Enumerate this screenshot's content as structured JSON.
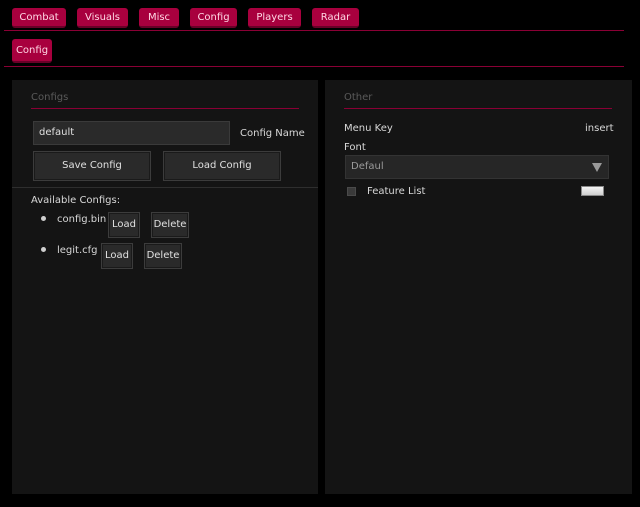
{
  "tabs": [
    {
      "label": "Combat"
    },
    {
      "label": "Visuals"
    },
    {
      "label": "Misc"
    },
    {
      "label": "Config"
    },
    {
      "label": "Players"
    },
    {
      "label": "Radar"
    }
  ],
  "subtab": {
    "label": "Config"
  },
  "configs_panel": {
    "title": "Configs",
    "config_name_value": "default",
    "config_name_label": "Config Name",
    "save_label": "Save Config",
    "load_label": "Load Config",
    "available_label": "Available Configs:",
    "items": [
      {
        "name": "config.bin",
        "load": "Load",
        "delete": "Delete"
      },
      {
        "name": "legit.cfg",
        "load": "Load",
        "delete": "Delete"
      }
    ]
  },
  "other_panel": {
    "title": "Other",
    "menu_key_label": "Menu Key",
    "menu_key_value": "insert",
    "font_label": "Font",
    "font_value": "Defaul",
    "feature_list_label": "Feature List",
    "feature_list_checked": false
  },
  "colors": {
    "accent": "#a8003e",
    "background": "#000000",
    "panel": "#141414"
  }
}
